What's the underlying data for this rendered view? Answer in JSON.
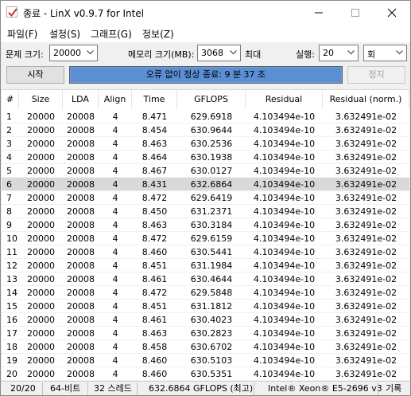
{
  "window": {
    "title": "종료 - LinX v0.9.7 for Intel",
    "icon": "checkbox-app-icon"
  },
  "menu": [
    {
      "label": "파일(F)"
    },
    {
      "label": "설정(S)"
    },
    {
      "label": "그래프(G)"
    },
    {
      "label": "정보(Z)"
    }
  ],
  "controls": {
    "problem_size_label": "문제 크기:",
    "problem_size_value": "20000",
    "memory_label": "메모리 크기(MB):",
    "memory_value": "3068",
    "max_label": "최대",
    "runs_label": "실행:",
    "runs_value": "20",
    "runs_unit": "회"
  },
  "buttons": {
    "start": "시작",
    "stop": "정지",
    "status_text": "오류 없이 정상 종료: 9 분 37 초"
  },
  "table": {
    "columns": [
      "#",
      "Size",
      "LDA",
      "Align",
      "Time",
      "GFLOPS",
      "Residual",
      "Residual (norm.)"
    ],
    "selected_row": 5,
    "rows": [
      [
        "1",
        "20000",
        "20008",
        "4",
        "8.471",
        "629.6918",
        "4.103494e-10",
        "3.632491e-02"
      ],
      [
        "2",
        "20000",
        "20008",
        "4",
        "8.454",
        "630.9644",
        "4.103494e-10",
        "3.632491e-02"
      ],
      [
        "3",
        "20000",
        "20008",
        "4",
        "8.463",
        "630.2536",
        "4.103494e-10",
        "3.632491e-02"
      ],
      [
        "4",
        "20000",
        "20008",
        "4",
        "8.464",
        "630.1938",
        "4.103494e-10",
        "3.632491e-02"
      ],
      [
        "5",
        "20000",
        "20008",
        "4",
        "8.467",
        "630.0127",
        "4.103494e-10",
        "3.632491e-02"
      ],
      [
        "6",
        "20000",
        "20008",
        "4",
        "8.431",
        "632.6864",
        "4.103494e-10",
        "3.632491e-02"
      ],
      [
        "7",
        "20000",
        "20008",
        "4",
        "8.472",
        "629.6419",
        "4.103494e-10",
        "3.632491e-02"
      ],
      [
        "8",
        "20000",
        "20008",
        "4",
        "8.450",
        "631.2371",
        "4.103494e-10",
        "3.632491e-02"
      ],
      [
        "9",
        "20000",
        "20008",
        "4",
        "8.463",
        "630.3184",
        "4.103494e-10",
        "3.632491e-02"
      ],
      [
        "10",
        "20000",
        "20008",
        "4",
        "8.472",
        "629.6159",
        "4.103494e-10",
        "3.632491e-02"
      ],
      [
        "11",
        "20000",
        "20008",
        "4",
        "8.460",
        "630.5441",
        "4.103494e-10",
        "3.632491e-02"
      ],
      [
        "12",
        "20000",
        "20008",
        "4",
        "8.451",
        "631.1984",
        "4.103494e-10",
        "3.632491e-02"
      ],
      [
        "13",
        "20000",
        "20008",
        "4",
        "8.461",
        "630.4644",
        "4.103494e-10",
        "3.632491e-02"
      ],
      [
        "14",
        "20000",
        "20008",
        "4",
        "8.472",
        "629.5848",
        "4.103494e-10",
        "3.632491e-02"
      ],
      [
        "15",
        "20000",
        "20008",
        "4",
        "8.451",
        "631.1812",
        "4.103494e-10",
        "3.632491e-02"
      ],
      [
        "16",
        "20000",
        "20008",
        "4",
        "8.461",
        "630.4023",
        "4.103494e-10",
        "3.632491e-02"
      ],
      [
        "17",
        "20000",
        "20008",
        "4",
        "8.463",
        "630.2823",
        "4.103494e-10",
        "3.632491e-02"
      ],
      [
        "18",
        "20000",
        "20008",
        "4",
        "8.458",
        "630.6702",
        "4.103494e-10",
        "3.632491e-02"
      ],
      [
        "19",
        "20000",
        "20008",
        "4",
        "8.460",
        "630.5103",
        "4.103494e-10",
        "3.632491e-02"
      ],
      [
        "20",
        "20000",
        "20008",
        "4",
        "8.460",
        "630.5351",
        "4.103494e-10",
        "3.632491e-02"
      ]
    ]
  },
  "statusbar": {
    "progress": "20/20",
    "bits": "64-비트",
    "threads": "32 스레드",
    "peak": "632.6864 GFLOPS (최고)",
    "cpu": "Intel® Xeon® E5-2696 v3",
    "log": "기록"
  },
  "colors": {
    "status_fill": "#5b8fd3",
    "selected_row": "#d9d9d9"
  }
}
